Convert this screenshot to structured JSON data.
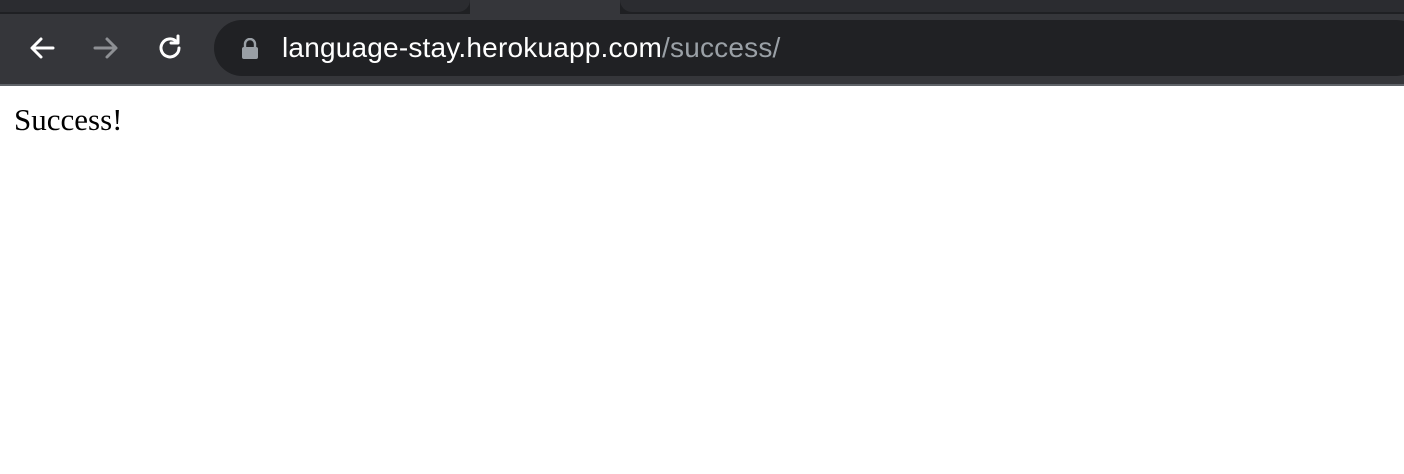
{
  "browser": {
    "address_bar": {
      "host": "language-stay.herokuapp.com",
      "path": "/success/",
      "secure": true
    },
    "icons": {
      "back": "arrow-left-icon",
      "forward": "arrow-right-icon",
      "reload": "reload-icon",
      "lock": "lock-icon"
    },
    "colors": {
      "chrome": "#35363a",
      "omnibox": "#202124",
      "host_text": "#ffffff",
      "path_text": "#9aa0a6",
      "forward_disabled": "#8e9094"
    }
  },
  "page": {
    "message": "Success!"
  }
}
